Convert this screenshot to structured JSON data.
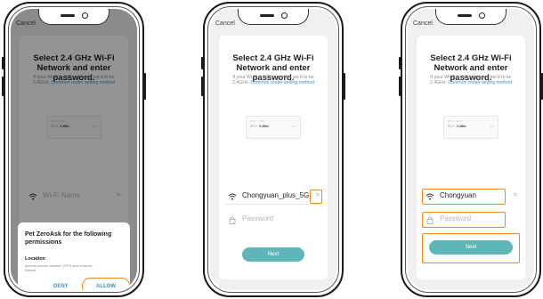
{
  "cancel_label": "Cancel",
  "title_line1": "Select 2.4 GHz Wi-Fi",
  "title_line2": "Network and enter password.",
  "subtitle": "If your Wi-Fi is 5GHz, please set it to be 2.4GHz.",
  "router_link": "Common router setting method",
  "router_illustration": {
    "row1": "Wi-Fi - 5Ghz",
    "row2_prefix": "Wi-Fi -",
    "row2_bold": "2.4Ghz",
    "row3": "a ⊙"
  },
  "wifi_placeholder": "Wi-Fi Name",
  "switch_label": "⇆",
  "password_placeholder": "Password",
  "next_label": "Next",
  "screens": {
    "step2": {
      "wifi_name": "Chongyuan_plus_5G"
    },
    "step3": {
      "wifi_name": "Chongyuan"
    }
  },
  "permission_dialog": {
    "title": "Pet ZeroAsk for the following permissions",
    "location_heading": "Location",
    "location_desc": "access precise location (GPS and network-based)",
    "deny_label": "DENY",
    "allow_label": "ALLOW"
  },
  "colors": {
    "accent": "#5fb6b8",
    "link": "#3f8fcf",
    "highlight": "#f08a20"
  }
}
